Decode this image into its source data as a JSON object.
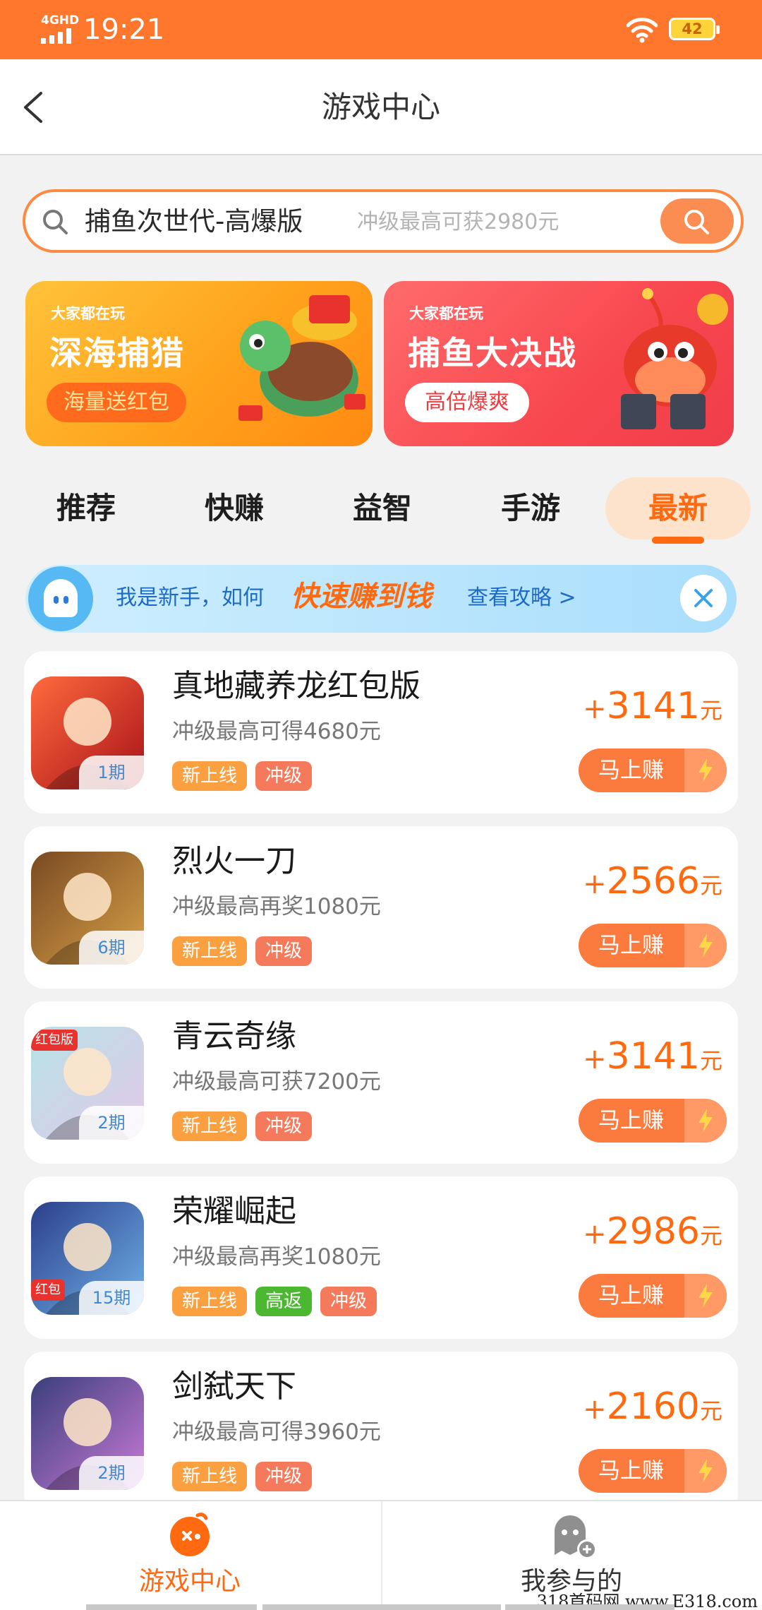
{
  "status_bar": {
    "network": "4GHD",
    "time": "19:21",
    "battery": "42"
  },
  "header": {
    "title": "游戏中心"
  },
  "search": {
    "query": "捕鱼次世代-高爆版",
    "placeholder": "冲级最高可获2980元"
  },
  "banners": [
    {
      "small": "大家都在玩",
      "title": "深海捕猎",
      "pill": "海量送红包"
    },
    {
      "small": "大家都在玩",
      "title": "捕鱼大决战",
      "pill": "高倍爆爽"
    }
  ],
  "tabs": [
    "推荐",
    "快赚",
    "益智",
    "手游",
    "最新"
  ],
  "active_tab": "最新",
  "tip": {
    "prefix": "我是新手，如何",
    "highlight": "快速赚到钱",
    "link": "查看攻略 >"
  },
  "games": [
    {
      "name": "真地藏养龙红包版",
      "desc": "冲级最高可得4680元",
      "period": "1期",
      "tags": [
        "新上线",
        "冲级"
      ],
      "plus": "+",
      "amount": "3141",
      "unit": "元",
      "button": "马上赚"
    },
    {
      "name": "烈火一刀",
      "desc": "冲级最高再奖1080元",
      "period": "6期",
      "tags": [
        "新上线",
        "冲级"
      ],
      "plus": "+",
      "amount": "2566",
      "unit": "元",
      "button": "马上赚"
    },
    {
      "name": "青云奇缘",
      "desc": "冲级最高可获7200元",
      "period": "2期",
      "thumb_badge": "红包版",
      "tags": [
        "新上线",
        "冲级"
      ],
      "plus": "+",
      "amount": "3141",
      "unit": "元",
      "button": "马上赚"
    },
    {
      "name": "荣耀崛起",
      "desc": "冲级最高再奖1080元",
      "period": "15期",
      "thumb_badge": "红包",
      "tags": [
        "新上线",
        "高返",
        "冲级"
      ],
      "plus": "+",
      "amount": "2986",
      "unit": "元",
      "button": "马上赚"
    },
    {
      "name": "剑弑天下",
      "desc": "冲级最高可得3960元",
      "period": "2期",
      "tags": [
        "新上线",
        "冲级"
      ],
      "plus": "+",
      "amount": "2160",
      "unit": "元",
      "button": "马上赚"
    }
  ],
  "tag_colors": {
    "新上线": "#fba041",
    "冲级": "#f57a5c",
    "高返": "#4cb832"
  },
  "bottom_nav": [
    {
      "label": "游戏中心"
    },
    {
      "label": "我参与的"
    }
  ],
  "watermark": "318首码网 www.E318.com",
  "colors": {
    "brand_orange": "#fe772d",
    "accent": "#ff6a10",
    "link_blue": "#1d6bc4"
  }
}
